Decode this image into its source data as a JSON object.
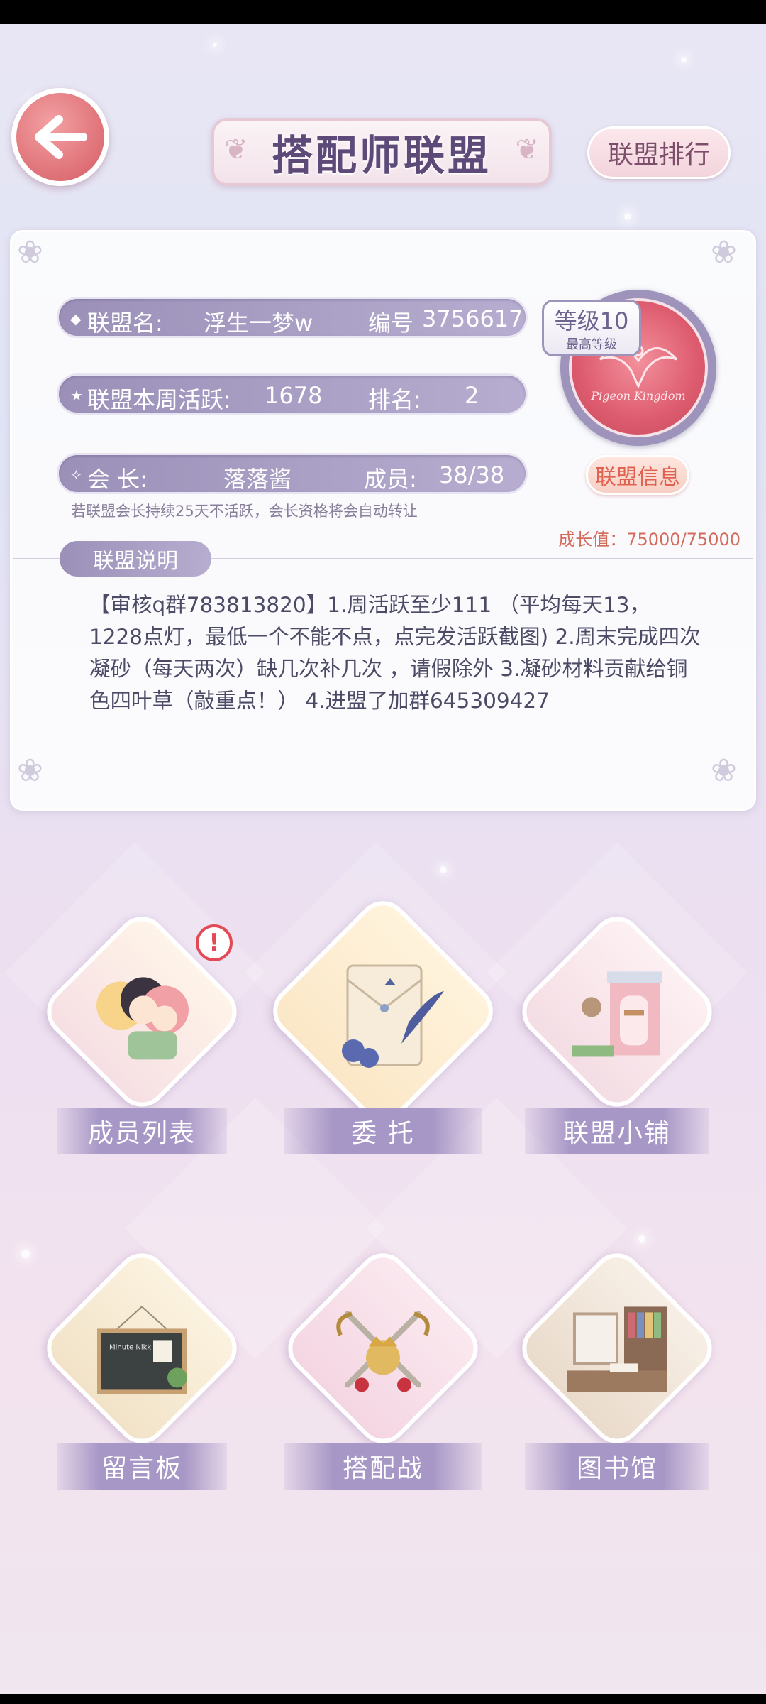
{
  "header": {
    "title": "搭配师联盟",
    "rank_button": "联盟排行"
  },
  "alliance": {
    "name_label": "联盟名:",
    "name": "浮生一梦w",
    "id_label": "编号",
    "id": "3756617",
    "weekly_label": "联盟本周活跃:",
    "weekly_activity": "1678",
    "rank_label": "排名:",
    "rank": "2",
    "leader_label": "会    长:",
    "leader": "落落酱",
    "members_label": "成员:",
    "members": "38/38",
    "level": "等级10",
    "level_note": "最高等级",
    "emblem_text": "Pigeon Kingdom",
    "info_button": "联盟信息",
    "notice": "若联盟会长持续25天不活跃，会长资格将会自动转让",
    "growth": "成长值：75000/75000"
  },
  "description": {
    "tab": "联盟说明",
    "text": "【审核q群783813820】1.周活跃至少111 （平均每天13，1228点灯，最低一个不能不点，点完发活跃截图) 2.周末完成四次凝砂（每天两次）缺几次补几次 ，请假除外    3.凝砂材料贡献给铜色四叶草（敲重点！） 4.进盟了加群645309427"
  },
  "menu": [
    {
      "label": "成员列表",
      "icon": "members-icon"
    },
    {
      "label": "委  托",
      "icon": "commission-icon"
    },
    {
      "label": "联盟小铺",
      "icon": "shop-icon"
    },
    {
      "label": "留言板",
      "icon": "message-board-icon"
    },
    {
      "label": "搭配战",
      "icon": "battle-icon"
    },
    {
      "label": "图书馆",
      "icon": "library-icon"
    }
  ],
  "alert_mark": "!",
  "board_text": "Minute Nikki"
}
